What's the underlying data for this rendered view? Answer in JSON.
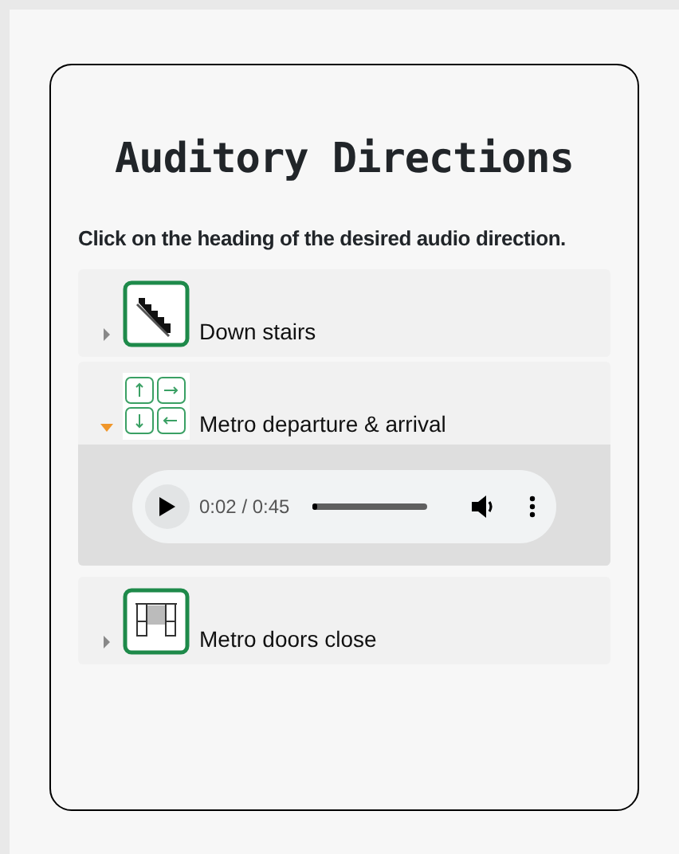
{
  "title": "Auditory Directions",
  "instruction": "Click on the heading of the desired audio direction.",
  "items": [
    {
      "label": "Down stairs",
      "kind": "stairs",
      "expanded": false
    },
    {
      "label": "Metro departure & arrival",
      "kind": "arrows",
      "expanded": true,
      "player": {
        "time": "0:02 / 0:45",
        "level": 0.05
      }
    },
    {
      "label": "Metro doors close",
      "kind": "doors",
      "expanded": false
    }
  ]
}
